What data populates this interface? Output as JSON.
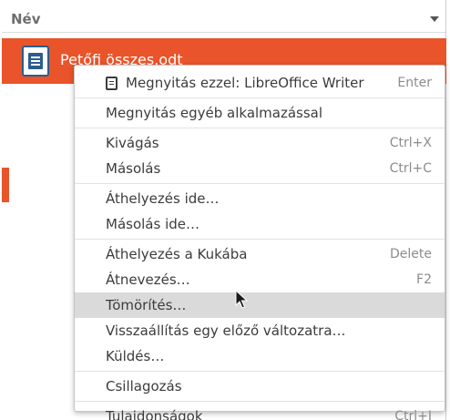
{
  "header": {
    "column_title": "Név"
  },
  "file": {
    "name": "Petőfi összes.odt",
    "icon": "document-icon"
  },
  "menu": {
    "items": [
      {
        "id": "open-with-writer",
        "label": "Megnyitás ezzel: LibreOffice Writer",
        "accel": "Enter",
        "icon": "writer-document-icon"
      },
      {
        "id": "open-with-other",
        "label": "Megnyitás egyéb alkalmazással",
        "accel": ""
      },
      {
        "id": "cut",
        "label": "Kivágás",
        "accel": "Ctrl+X"
      },
      {
        "id": "copy",
        "label": "Másolás",
        "accel": "Ctrl+C"
      },
      {
        "id": "move-to",
        "label": "Áthelyezés ide…",
        "accel": ""
      },
      {
        "id": "copy-to",
        "label": "Másolás ide…",
        "accel": ""
      },
      {
        "id": "move-to-trash",
        "label": "Áthelyezés a Kukába",
        "accel": "Delete"
      },
      {
        "id": "rename",
        "label": "Átnevezés…",
        "accel": "F2"
      },
      {
        "id": "compress",
        "label": "Tömörítés…",
        "accel": "",
        "hovered": true
      },
      {
        "id": "restore-previous",
        "label": "Visszaállítás egy előző változatra…",
        "accel": ""
      },
      {
        "id": "send",
        "label": "Küldés…",
        "accel": ""
      },
      {
        "id": "star",
        "label": "Csillagozás",
        "accel": ""
      },
      {
        "id": "properties",
        "label": "Tulajdonságok",
        "accel": "Ctrl+I"
      }
    ]
  },
  "colors": {
    "selection": "#e9542a",
    "menu_hover": "#dadada",
    "accel_text": "#8c8c8c"
  }
}
